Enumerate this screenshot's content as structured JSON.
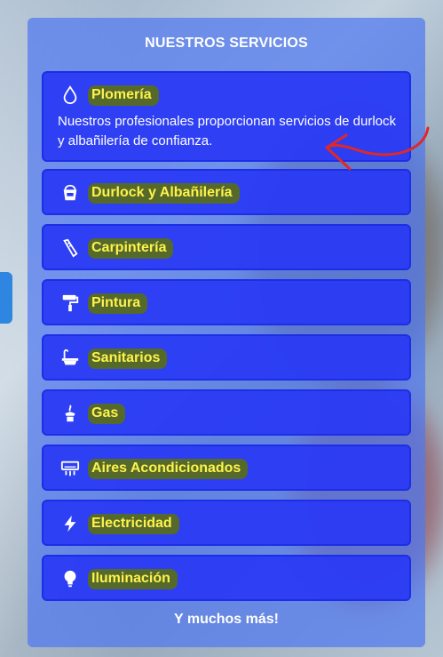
{
  "section": {
    "title": "NUESTROS SERVICIOS",
    "footer": "Y muchos más!"
  },
  "services": [
    {
      "label": "Plomería",
      "icon": "water-drop-icon",
      "description": "Nuestros profesionales proporcionan servicios de durlock y albañilería de confianza.",
      "expanded": true
    },
    {
      "label": "Durlock y Albañilería",
      "icon": "paint-bucket-icon"
    },
    {
      "label": "Carpintería",
      "icon": "saw-icon"
    },
    {
      "label": "Pintura",
      "icon": "paint-roller-icon"
    },
    {
      "label": "Sanitarios",
      "icon": "bathtub-icon"
    },
    {
      "label": "Gas",
      "icon": "gas-burner-icon"
    },
    {
      "label": "Aires Acondicionados",
      "icon": "air-conditioner-icon"
    },
    {
      "label": "Electricidad",
      "icon": "lightning-icon"
    },
    {
      "label": "Iluminación",
      "icon": "lightbulb-icon"
    }
  ],
  "colors": {
    "panel": "#5078f0",
    "card": "#2837f5",
    "label_text": "#fff34a",
    "label_highlight": "#5a6e14",
    "annotation": "#e02828"
  }
}
